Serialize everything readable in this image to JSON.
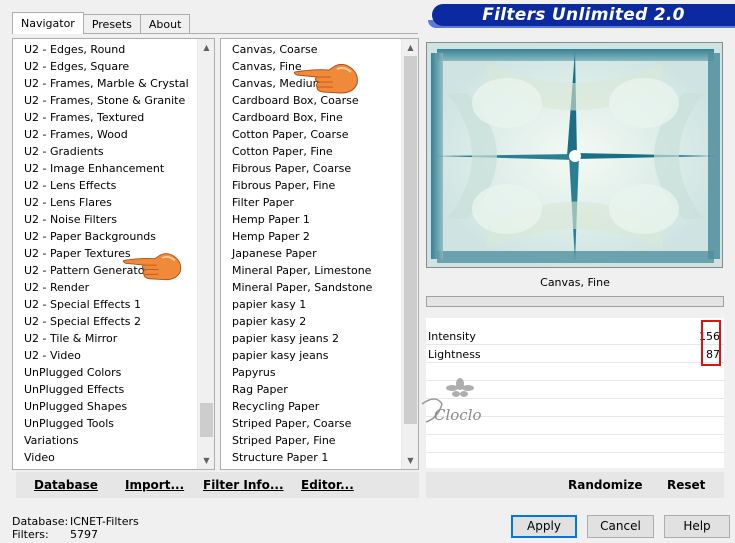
{
  "tabs": [
    {
      "label": "Navigator"
    },
    {
      "label": "Presets"
    },
    {
      "label": "About"
    }
  ],
  "app_title": "Filters Unlimited 2.0",
  "categories": [
    "U2 - Edges, Round",
    "U2 - Edges, Square",
    "U2 - Frames, Marble & Crystal",
    "U2 - Frames, Stone & Granite",
    "U2 - Frames, Textured",
    "U2 - Frames, Wood",
    "U2 - Gradients",
    "U2 - Image Enhancement",
    "U2 - Lens Effects",
    "U2 - Lens Flares",
    "U2 - Noise Filters",
    "U2 - Paper Backgrounds",
    "U2 - Paper Textures",
    "U2 - Pattern Generators",
    "U2 - Render",
    "U2 - Special Effects 1",
    "U2 - Special Effects 2",
    "U2 - Tile & Mirror",
    "U2 - Video",
    "UnPlugged Colors",
    "UnPlugged Effects",
    "UnPlugged Shapes",
    "UnPlugged Tools",
    "Variations",
    "Video"
  ],
  "filters": [
    "Canvas, Coarse",
    "Canvas, Fine",
    "Canvas, Medium",
    "Cardboard Box, Coarse",
    "Cardboard Box, Fine",
    "Cotton Paper, Coarse",
    "Cotton Paper, Fine",
    "Fibrous Paper, Coarse",
    "Fibrous Paper, Fine",
    "Filter Paper",
    "Hemp Paper 1",
    "Hemp Paper 2",
    "Japanese Paper",
    "Mineral Paper, Limestone",
    "Mineral Paper, Sandstone",
    "papier kasy 1",
    "papier kasy 2",
    "papier kasy jeans 2",
    "papier kasy jeans",
    "Papyrus",
    "Rag Paper",
    "Recycling Paper",
    "Striped Paper, Coarse",
    "Striped Paper, Fine",
    "Structure Paper 1"
  ],
  "selected_filter_name": "Canvas, Fine",
  "params": [
    {
      "label": "Intensity",
      "value": "156"
    },
    {
      "label": "Lightness",
      "value": "87"
    }
  ],
  "watermark_text": "Cloclo",
  "toolbar": {
    "database": "Database",
    "import": "Import...",
    "filter_info": "Filter Info...",
    "editor": "Editor...",
    "randomize": "Randomize",
    "reset": "Reset"
  },
  "status": {
    "database_label": "Database:",
    "database_value": "ICNET-Filters",
    "filters_label": "Filters:",
    "filters_value": "5797"
  },
  "buttons": {
    "apply": "Apply",
    "cancel": "Cancel",
    "help": "Help"
  },
  "colors": {
    "brand_blue": "#0b2aa0",
    "highlight_red": "#e01010",
    "default_button_border": "#0078d7",
    "preview_teal": "#1a6f86"
  },
  "icons": {
    "pointer": "pointing-hand-icon"
  }
}
